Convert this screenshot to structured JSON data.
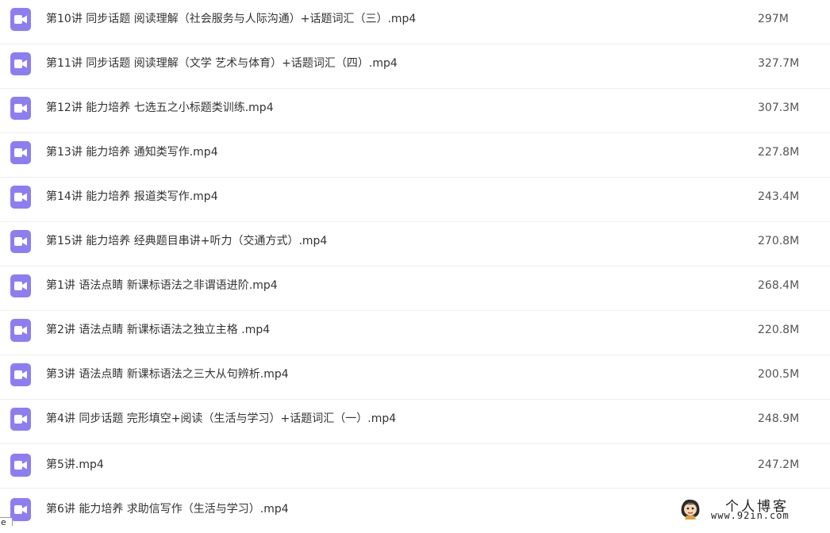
{
  "files": [
    {
      "name": "第10讲 同步话题 阅读理解（社会服务与人际沟通）+话题词汇（三）.mp4",
      "size": "297M",
      "icon": "video-file-icon"
    },
    {
      "name": "第11讲 同步话题 阅读理解（文学 艺术与体育）+话题词汇（四）.mp4",
      "size": "327.7M",
      "icon": "video-file-icon"
    },
    {
      "name": "第12讲 能力培养 七选五之小标题类训练.mp4",
      "size": "307.3M",
      "icon": "video-file-icon"
    },
    {
      "name": "第13讲 能力培养 通知类写作.mp4",
      "size": "227.8M",
      "icon": "video-file-icon"
    },
    {
      "name": "第14讲 能力培养 报道类写作.mp4",
      "size": "243.4M",
      "icon": "video-file-icon"
    },
    {
      "name": "第15讲 能力培养 经典题目串讲+听力（交通方式）.mp4",
      "size": "270.8M",
      "icon": "video-file-icon"
    },
    {
      "name": "第1讲 语法点睛 新课标语法之非谓语进阶.mp4",
      "size": "268.4M",
      "icon": "video-file-icon"
    },
    {
      "name": "第2讲 语法点睛 新课标语法之独立主格 .mp4",
      "size": "220.8M",
      "icon": "video-file-icon"
    },
    {
      "name": "第3讲 语法点睛 新课标语法之三大从句辨析.mp4",
      "size": "200.5M",
      "icon": "video-file-icon"
    },
    {
      "name": "第4讲 同步话题 完形填空+阅读（生活与学习）+话题词汇（一）.mp4",
      "size": "248.9M",
      "icon": "video-file-icon"
    },
    {
      "name": "第5讲.mp4",
      "size": "247.2M",
      "icon": "video-file-icon"
    },
    {
      "name": "第6讲 能力培养 求助信写作（生活与学习）.mp4",
      "size": "",
      "icon": "video-file-icon"
    }
  ],
  "corner_tab": {
    "text": "e"
  },
  "watermark": {
    "title": "个人博客",
    "url": "www.92in.com",
    "mascot_icon": "mascot-icon"
  },
  "colors": {
    "icon_bg": "#8c7ef2",
    "divider": "#eeeeee",
    "text": "#333333"
  }
}
